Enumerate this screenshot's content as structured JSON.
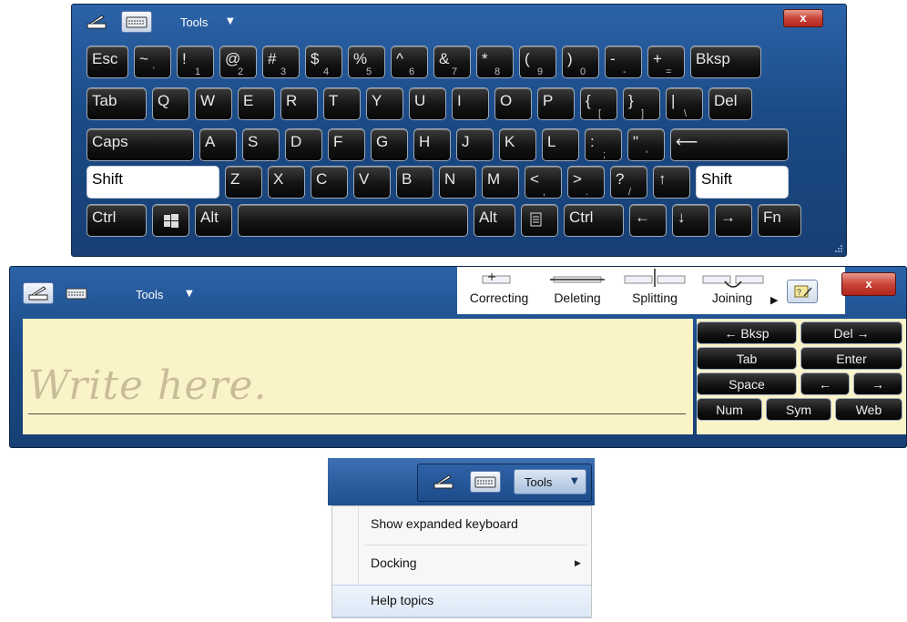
{
  "keyboard": {
    "tools_label": "Tools",
    "close_label": "x",
    "rows": [
      [
        {
          "main": "Esc"
        },
        {
          "main": "~",
          "sec": "`"
        },
        {
          "main": "!",
          "sec": "1"
        },
        {
          "main": "@",
          "sec": "2"
        },
        {
          "main": "#",
          "sec": "3"
        },
        {
          "main": "$",
          "sec": "4"
        },
        {
          "main": "%",
          "sec": "5"
        },
        {
          "main": "^",
          "sec": "6"
        },
        {
          "main": "&",
          "sec": "7"
        },
        {
          "main": "*",
          "sec": "8"
        },
        {
          "main": "(",
          "sec": "9"
        },
        {
          "main": ")",
          "sec": "0"
        },
        {
          "main": "-",
          "sec": "-"
        },
        {
          "main": "+",
          "sec": "="
        },
        {
          "main": "Bksp"
        }
      ],
      [
        {
          "main": "Tab"
        },
        {
          "main": "Q"
        },
        {
          "main": "W"
        },
        {
          "main": "E"
        },
        {
          "main": "R"
        },
        {
          "main": "T"
        },
        {
          "main": "Y"
        },
        {
          "main": "U"
        },
        {
          "main": "I"
        },
        {
          "main": "O"
        },
        {
          "main": "P"
        },
        {
          "main": "{",
          "sec": "["
        },
        {
          "main": "}",
          "sec": "]"
        },
        {
          "main": "|",
          "sec": "\\"
        },
        {
          "main": "Del"
        }
      ],
      [
        {
          "main": "Caps"
        },
        {
          "main": "A"
        },
        {
          "main": "S"
        },
        {
          "main": "D"
        },
        {
          "main": "F"
        },
        {
          "main": "G"
        },
        {
          "main": "H"
        },
        {
          "main": "J"
        },
        {
          "main": "K"
        },
        {
          "main": "L"
        },
        {
          "main": ":",
          "sec": ";"
        },
        {
          "main": "\"",
          "sec": "'"
        },
        {
          "main": "⟵"
        }
      ],
      [
        {
          "main": "Shift"
        },
        {
          "main": "Z"
        },
        {
          "main": "X"
        },
        {
          "main": "C"
        },
        {
          "main": "V"
        },
        {
          "main": "B"
        },
        {
          "main": "N"
        },
        {
          "main": "M"
        },
        {
          "main": "<",
          "sec": ","
        },
        {
          "main": ">",
          "sec": "."
        },
        {
          "main": "?",
          "sec": "/"
        },
        {
          "main": "↑"
        },
        {
          "main": "Shift"
        }
      ],
      [
        {
          "main": "Ctrl"
        },
        {
          "main": ""
        },
        {
          "main": "Alt"
        },
        {
          "main": ""
        },
        {
          "main": "Alt"
        },
        {
          "main": ""
        },
        {
          "main": "Ctrl"
        },
        {
          "main": "←"
        },
        {
          "main": "↓"
        },
        {
          "main": "→"
        },
        {
          "main": "Fn"
        }
      ]
    ]
  },
  "handwriting": {
    "tools_label": "Tools",
    "close_label": "x",
    "gestures": [
      "Correcting",
      "Deleting",
      "Splitting",
      "Joining"
    ],
    "placeholder": "Write here.",
    "keys": {
      "bksp": "← Bksp",
      "del": "Del →",
      "tab": "Tab",
      "enter": "Enter",
      "space": "Space",
      "left": "←",
      "right": "→",
      "num": "Num",
      "sym": "Sym",
      "web": "Web"
    }
  },
  "tools_menu": {
    "tools_label": "Tools",
    "items": [
      {
        "label": "Show expanded keyboard"
      },
      {
        "label": "Docking",
        "has_submenu": true
      },
      {
        "label": "Help topics"
      }
    ]
  }
}
